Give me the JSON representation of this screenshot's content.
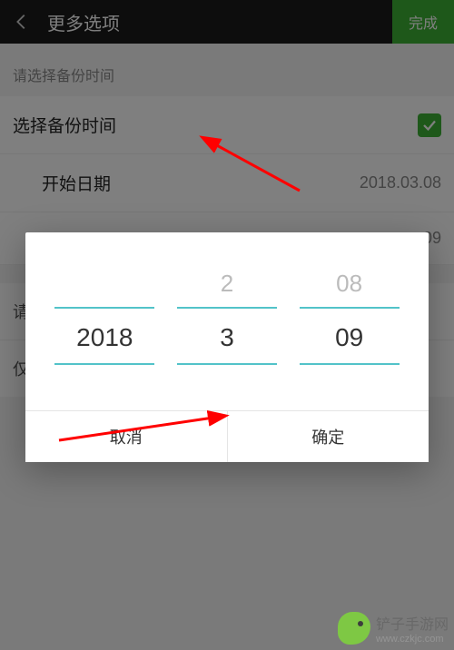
{
  "header": {
    "title": "更多选项",
    "done": "完成"
  },
  "hint": "请选择备份时间",
  "rows": {
    "select_time": "选择备份时间",
    "start_date_label": "开始日期",
    "start_date_value": "2018.03.08",
    "end_date_partial": "09"
  },
  "cutoff": {
    "r1": "请",
    "r2": "仅"
  },
  "picker": {
    "year_prev": "",
    "year_sel": "2018",
    "month_prev": "2",
    "month_sel": "3",
    "day_prev": "08",
    "day_sel": "09"
  },
  "dialog": {
    "cancel": "取消",
    "ok": "确定"
  },
  "watermark": {
    "brand": "铲子手游网",
    "url": "www.czkjc.com"
  }
}
